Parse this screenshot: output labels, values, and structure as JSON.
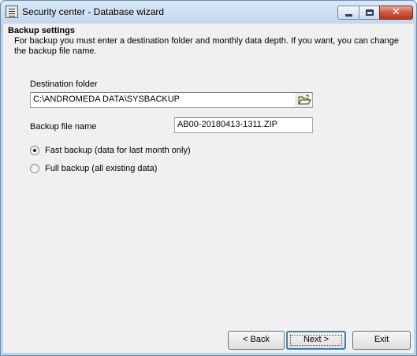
{
  "window": {
    "title": "Security center - Database wizard"
  },
  "header": {
    "title": "Backup settings",
    "description": "For backup you must enter a destination folder and monthly data depth. If you want, you can change the backup file name."
  },
  "form": {
    "destination_label": "Destination folder",
    "destination_value": "C:\\ANDROMEDA DATA\\SYSBACKUP",
    "browse_icon": "folder-open-icon",
    "filename_label": "Backup file name",
    "filename_value": "AB00-20180413-1311.ZIP",
    "options": [
      {
        "label": "Fast backup (data for last month only)",
        "selected": true
      },
      {
        "label": "Full backup (all existing data)",
        "selected": false
      }
    ]
  },
  "footer": {
    "back_label": "< Back",
    "next_label": "Next >",
    "exit_label": "Exit"
  }
}
